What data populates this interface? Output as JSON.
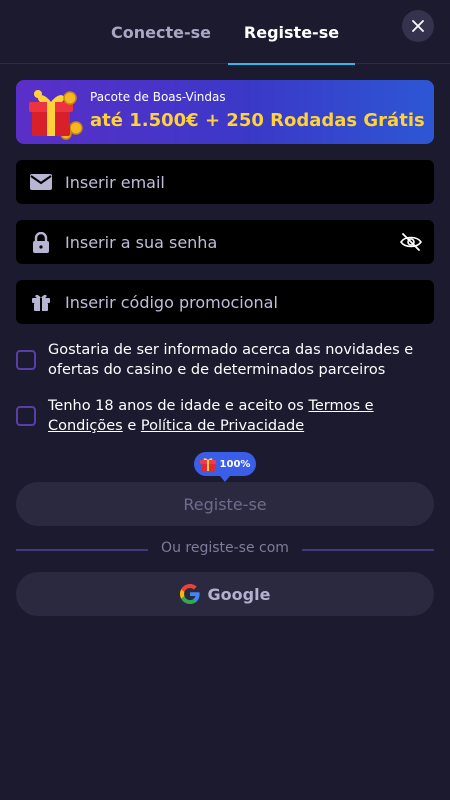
{
  "tabs": {
    "login_label": "Conecte-se",
    "register_label": "Registe-se",
    "active": "register"
  },
  "close_icon": "close-icon",
  "banner": {
    "subtitle": "Pacote de Boas-Vindas",
    "headline": "até 1.500€ + 250 Rodadas Grátis",
    "icon": "gift-icon"
  },
  "form": {
    "email_placeholder": "Inserir email",
    "password_placeholder": "Inserir a sua senha",
    "promo_placeholder": "Inserir código promocional",
    "icons": [
      "envelope-icon",
      "lock-icon",
      "eye-off-icon",
      "gift-icon"
    ]
  },
  "consents": {
    "marketing_text": "Gostaria de ser informado acerca das novidades e ofertas do casino e de determinados parceiros",
    "age_prefix": "Tenho 18 anos de idade e aceito os ",
    "terms_link": "Termos e Condições",
    "age_conjunction": " e ",
    "privacy_link": "Política de Privacidade"
  },
  "bonus_badge": {
    "label": "100%"
  },
  "submit_label": "Registe-se",
  "alt_register": {
    "divider_text": "Ou registe-se com",
    "google_label": "Google"
  },
  "colors": {
    "background": "#1c1a2e",
    "accent_underline": "#2fb8e8",
    "banner_highlight": "#ffd23a",
    "badge": "#3a5ee8"
  }
}
